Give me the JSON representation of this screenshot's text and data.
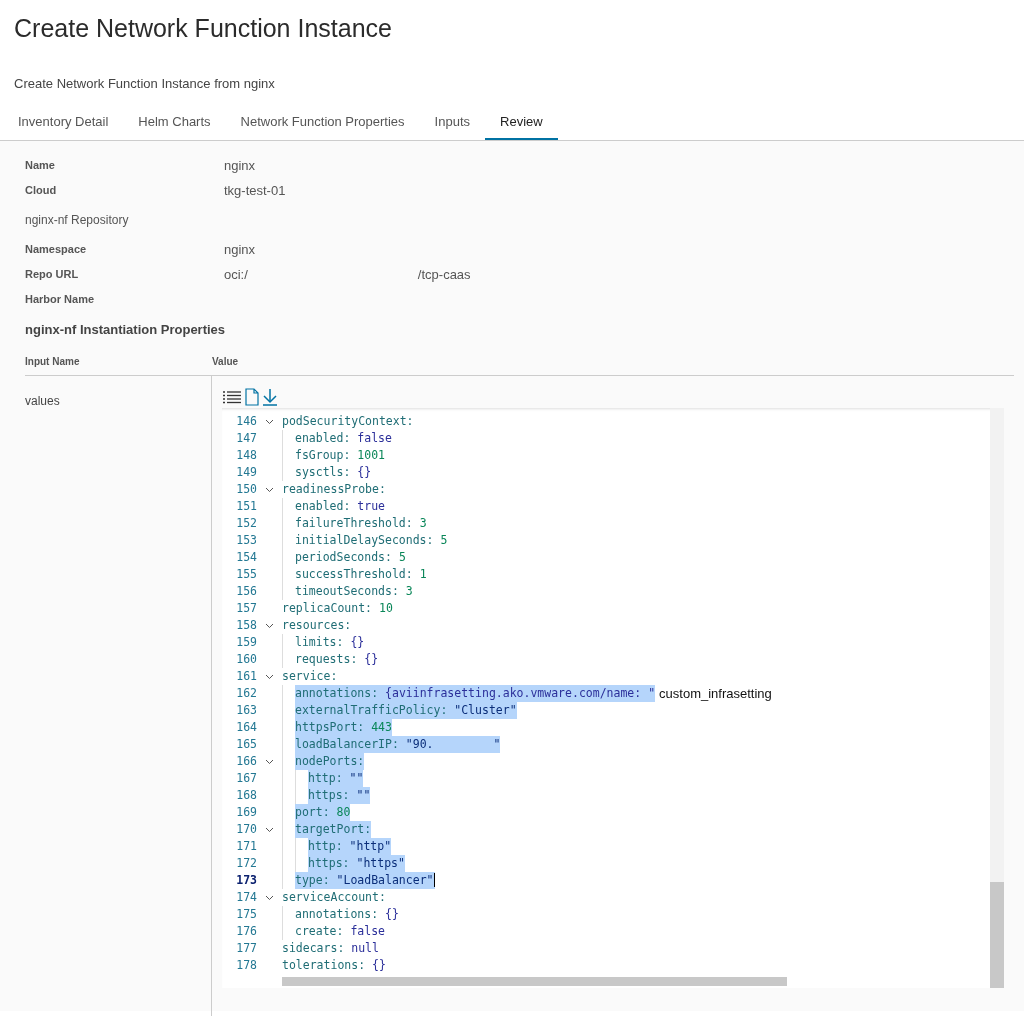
{
  "page": {
    "title": "Create Network Function Instance",
    "subtitle": "Create Network Function Instance from nginx"
  },
  "tabs": [
    {
      "label": "Inventory Detail",
      "selected": false
    },
    {
      "label": "Helm Charts",
      "selected": false
    },
    {
      "label": "Network Function Properties",
      "selected": false
    },
    {
      "label": "Inputs",
      "selected": false
    },
    {
      "label": "Review",
      "selected": true
    }
  ],
  "details": [
    {
      "kind": "field",
      "label": "Name",
      "values": [
        "nginx"
      ]
    },
    {
      "kind": "field",
      "label": "Cloud",
      "values": [
        "tkg-test-01"
      ]
    },
    {
      "kind": "subheading",
      "label": "nginx-nf Repository"
    },
    {
      "kind": "field",
      "label": "Namespace",
      "values": [
        "nginx"
      ]
    },
    {
      "kind": "field",
      "label": "Repo URL",
      "values": [
        "oci:/",
        "/tcp-caas"
      ]
    },
    {
      "kind": "field",
      "label": "Harbor Name"
    },
    {
      "kind": "heading",
      "label": "nginx-nf Instantiation Properties"
    }
  ],
  "table": {
    "columns": [
      "Input Name",
      "Value"
    ],
    "rows": [
      {
        "name": "values",
        "editor": {
          "lines": [
            {
              "num": "146",
              "key": "podSecurityContext:",
              "selected": false,
              "current": false,
              "expanded": true,
              "children": [
                {
                  "num": "147",
                  "key": "enabled:",
                  "value": "false",
                  "kind": "keyword",
                  "selected": false,
                  "current": false
                },
                {
                  "num": "148",
                  "key": "fsGroup:",
                  "value": "1001",
                  "kind": "number",
                  "selected": false,
                  "current": false
                },
                {
                  "num": "149",
                  "key": "sysctls:",
                  "value": "{}",
                  "kind": "keyword",
                  "selected": false,
                  "current": false
                }
              ]
            },
            {
              "num": "150",
              "key": "readinessProbe:",
              "selected": false,
              "current": false,
              "expanded": true,
              "children": [
                {
                  "num": "151",
                  "key": "enabled:",
                  "value": "true",
                  "kind": "keyword",
                  "selected": false,
                  "current": false
                },
                {
                  "num": "152",
                  "key": "failureThreshold:",
                  "value": "3",
                  "kind": "number",
                  "selected": false,
                  "current": false
                },
                {
                  "num": "153",
                  "key": "initialDelaySeconds:",
                  "value": "5",
                  "kind": "number",
                  "selected": false,
                  "current": false
                },
                {
                  "num": "154",
                  "key": "periodSeconds:",
                  "value": "5",
                  "kind": "number",
                  "selected": false,
                  "current": false
                },
                {
                  "num": "155",
                  "key": "successThreshold:",
                  "value": "1",
                  "kind": "number",
                  "selected": false,
                  "current": false
                },
                {
                  "num": "156",
                  "key": "timeoutSeconds:",
                  "value": "3",
                  "kind": "number",
                  "selected": false,
                  "current": false
                }
              ]
            },
            {
              "num": "157",
              "key": "replicaCount:",
              "value": "10",
              "kind": "number",
              "selected": false,
              "current": false
            },
            {
              "num": "158",
              "key": "resources:",
              "selected": false,
              "current": false,
              "expanded": true,
              "children": [
                {
                  "num": "159",
                  "key": "limits:",
                  "value": "{}",
                  "kind": "keyword",
                  "selected": false,
                  "current": false
                },
                {
                  "num": "160",
                  "key": "requests:",
                  "value": "{}",
                  "kind": "keyword",
                  "selected": false,
                  "current": false
                }
              ]
            },
            {
              "num": "161",
              "key": "service:",
              "selected": false,
              "current": false,
              "expanded": true,
              "children": [
                {
                  "num": "162",
                  "key": "annotations:",
                  "value": "{aviinfrasetting.ako.vmware.com/name: \"",
                  "kind": "keyword",
                  "overlay": "custom_infrasetting",
                  "selected": true,
                  "current": false
                },
                {
                  "num": "163",
                  "key": "externalTrafficPolicy:",
                  "value": "\"Cluster\"",
                  "kind": "string",
                  "selected": true,
                  "current": false
                },
                {
                  "num": "164",
                  "key": "httpsPort:",
                  "value": "443",
                  "kind": "number",
                  "selected": true,
                  "current": false
                },
                {
                  "num": "165",
                  "key": "loadBalancerIP:",
                  "value": "\"90.",
                  "value_tail": "\"",
                  "kind": "string",
                  "selected": true,
                  "current": false
                },
                {
                  "num": "166",
                  "key": "nodePorts:",
                  "selected": true,
                  "current": false,
                  "expanded": true,
                  "children": [
                    {
                      "num": "167",
                      "key": "http:",
                      "value": "\"\"",
                      "kind": "string",
                      "selected": true,
                      "current": false
                    },
                    {
                      "num": "168",
                      "key": "https:",
                      "value": "\"\"",
                      "kind": "string",
                      "selected": true,
                      "current": false
                    }
                  ]
                },
                {
                  "num": "169",
                  "key": "port:",
                  "value": "80",
                  "kind": "number",
                  "selected": true,
                  "current": false
                },
                {
                  "num": "170",
                  "key": "targetPort:",
                  "selected": true,
                  "current": false,
                  "expanded": true,
                  "children": [
                    {
                      "num": "171",
                      "key": "http:",
                      "value": "\"http\"",
                      "kind": "string",
                      "selected": true,
                      "current": false
                    },
                    {
                      "num": "172",
                      "key": "https:",
                      "value": "\"https\"",
                      "kind": "string",
                      "selected": true,
                      "current": false
                    }
                  ]
                },
                {
                  "num": "173",
                  "key": "type:",
                  "value": "\"LoadBalancer\"",
                  "kind": "string",
                  "selected": true,
                  "current": true
                }
              ]
            },
            {
              "num": "174",
              "key": "serviceAccount:",
              "selected": false,
              "current": false,
              "expanded": true,
              "children": [
                {
                  "num": "175",
                  "key": "annotations:",
                  "value": "{}",
                  "kind": "keyword",
                  "selected": false,
                  "current": false
                },
                {
                  "num": "176",
                  "key": "create:",
                  "value": "false",
                  "kind": "keyword",
                  "selected": false,
                  "current": false
                }
              ]
            },
            {
              "num": "177",
              "key": "sidecars:",
              "value": "null",
              "kind": "keyword",
              "selected": false,
              "current": false
            },
            {
              "num": "178",
              "key": "tolerations:",
              "value": "{}",
              "kind": "keyword",
              "selected": false,
              "current": false
            }
          ]
        }
      }
    ]
  }
}
